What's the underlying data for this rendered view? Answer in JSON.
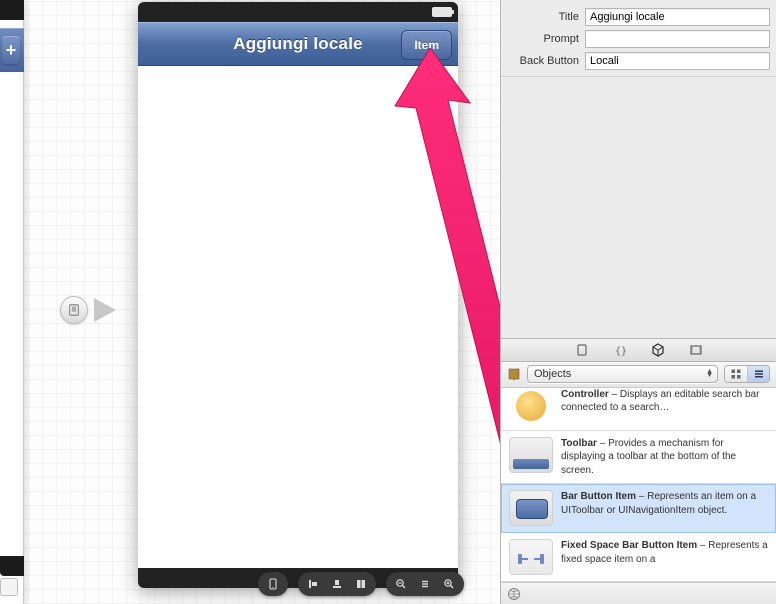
{
  "scene": {
    "nav_title": "Aggiungi locale",
    "right_button_label": "Item"
  },
  "inspector": {
    "rows": [
      {
        "label": "Title",
        "value": "Aggiungi locale"
      },
      {
        "label": "Prompt",
        "value": ""
      },
      {
        "label": "Back Button",
        "value": "Locali"
      }
    ]
  },
  "library": {
    "popup_label": "Objects",
    "items": [
      {
        "partial": true,
        "title": "Controller",
        "desc": "Displays an editable search bar connected to a search…"
      },
      {
        "title": "Toolbar",
        "desc": "Provides a mechanism for displaying a toolbar at the bottom of the screen."
      },
      {
        "selected": true,
        "title": "Bar Button Item",
        "desc": "Represents an item on a UIToolbar or UINavigationItem object."
      },
      {
        "title": "Fixed Space Bar Button Item",
        "desc": "Represents a fixed space item on a"
      }
    ]
  }
}
